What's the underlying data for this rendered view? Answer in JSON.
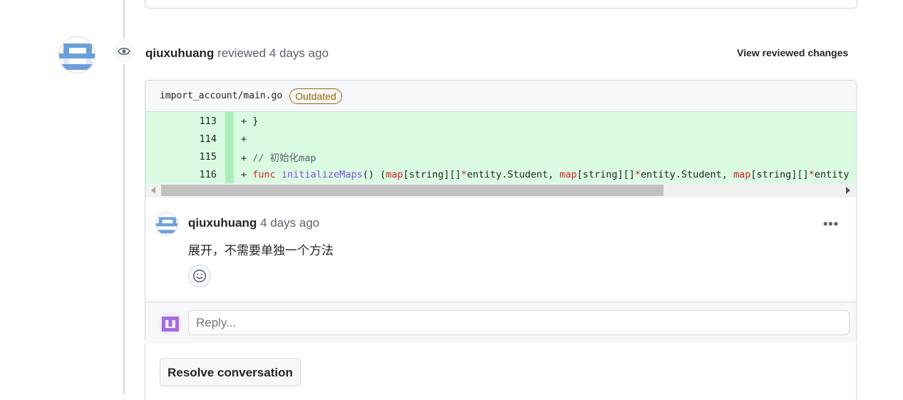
{
  "review": {
    "author": "qiuxuhuang",
    "action": "reviewed",
    "time": "4 days ago",
    "view_changes_label": "View reviewed changes"
  },
  "file": {
    "path": "import_account/main.go",
    "status_badge": "Outdated"
  },
  "diff": {
    "lines": [
      {
        "num": "113",
        "sign": "+",
        "text": "}"
      },
      {
        "num": "114",
        "sign": "+",
        "text": ""
      },
      {
        "num": "115",
        "sign": "+",
        "text": "// 初始化map"
      },
      {
        "num": "116",
        "sign": "+",
        "text": "func initializeMaps() (map[string][]*entity.Student, map[string][]*entity.Student, map[string][]*entity"
      }
    ]
  },
  "comment": {
    "author": "qiuxuhuang",
    "time": "4 days ago",
    "body": "展开，不需要单独一个方法",
    "menu_icon": "kebab-horizontal-icon",
    "reaction_icon": "smiley-icon"
  },
  "reply": {
    "placeholder": "Reply..."
  },
  "resolve_label": "Resolve conversation",
  "colors": {
    "addition_bg": "#dafbe1",
    "addition_gutter": "#aceebb",
    "outdated": "#9a6700",
    "keyword": "#cf222e",
    "function": "#8250df"
  }
}
